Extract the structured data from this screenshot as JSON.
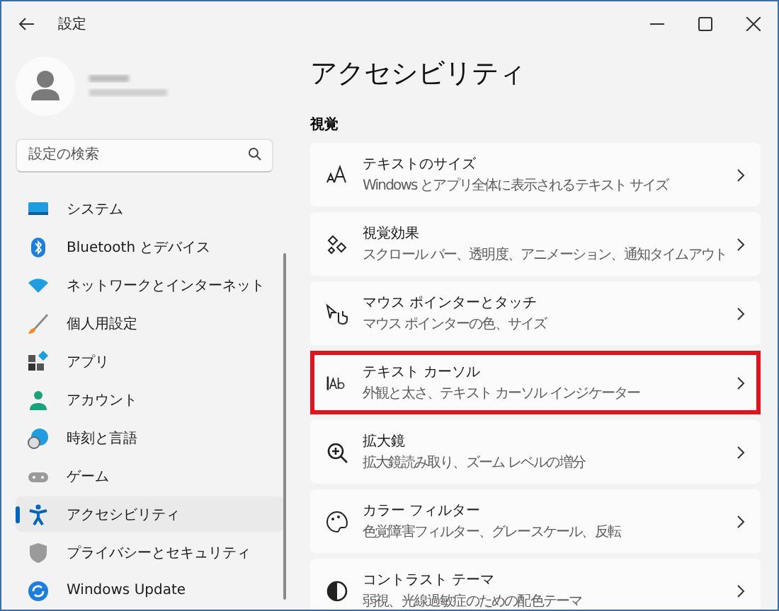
{
  "window": {
    "title": "設定"
  },
  "search": {
    "placeholder": "設定の検索"
  },
  "sidebar": {
    "items": [
      {
        "label": "システム",
        "selected": false
      },
      {
        "label": "Bluetooth とデバイス",
        "selected": false
      },
      {
        "label": "ネットワークとインターネット",
        "selected": false
      },
      {
        "label": "個人用設定",
        "selected": false
      },
      {
        "label": "アプリ",
        "selected": false
      },
      {
        "label": "アカウント",
        "selected": false
      },
      {
        "label": "時刻と言語",
        "selected": false
      },
      {
        "label": "ゲーム",
        "selected": false
      },
      {
        "label": "アクセシビリティ",
        "selected": true
      },
      {
        "label": "プライバシーとセキュリティ",
        "selected": false
      },
      {
        "label": "Windows Update",
        "selected": false
      }
    ]
  },
  "page": {
    "title": "アクセシビリティ",
    "section": "視覚",
    "items": [
      {
        "title": "テキストのサイズ",
        "subtitle": "Windows とアプリ全体に表示されるテキスト サイズ",
        "highlighted": false
      },
      {
        "title": "視覚効果",
        "subtitle": "スクロール バー、透明度、アニメーション、通知タイムアウト",
        "highlighted": false
      },
      {
        "title": "マウス ポインターとタッチ",
        "subtitle": "マウス ポインターの色、サイズ",
        "highlighted": false
      },
      {
        "title": "テキスト カーソル",
        "subtitle": "外観と太さ、テキスト カーソル インジケーター",
        "highlighted": true
      },
      {
        "title": "拡大鏡",
        "subtitle": "拡大鏡読み取り、ズーム レベルの増分",
        "highlighted": false
      },
      {
        "title": "カラー フィルター",
        "subtitle": "色覚障害フィルター、グレースケール、反転",
        "highlighted": false
      },
      {
        "title": "コントラスト テーマ",
        "subtitle": "弱視、光線過敏症のための配色テーマ",
        "highlighted": false
      }
    ]
  }
}
